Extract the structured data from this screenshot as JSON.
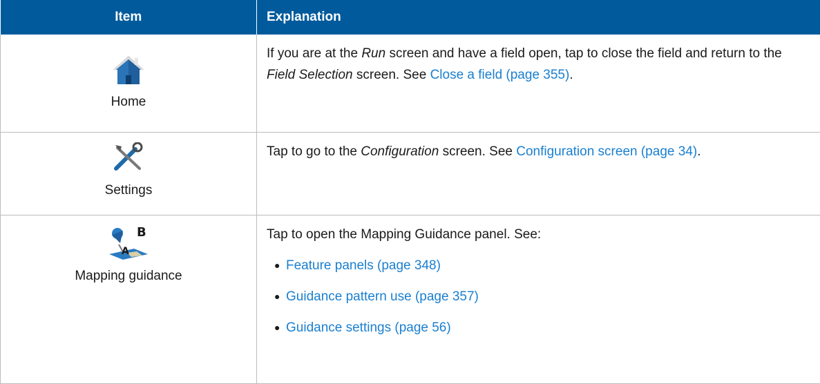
{
  "header": {
    "item": "Item",
    "explanation": "Explanation"
  },
  "rows": [
    {
      "icon": "home-icon",
      "label": "Home",
      "text": [
        "If you are at the ",
        "Run",
        " screen and have a field open, tap to close the field and return to the ",
        "Field Selection",
        " screen. See ",
        "Close a field (page 355)",
        "."
      ]
    },
    {
      "icon": "settings-icon",
      "label": "Settings",
      "text": [
        "Tap to go to the ",
        "Configuration",
        " screen. See ",
        "Configuration screen (page 34)",
        "."
      ]
    },
    {
      "icon": "mapping-guidance-icon",
      "label": "Mapping guidance",
      "text": [
        "Tap to open the Mapping Guidance panel. See:"
      ],
      "links": [
        "Feature panels (page 348)",
        "Guidance pattern use (page 357)",
        "Guidance settings (page 56)"
      ]
    }
  ],
  "colors": {
    "header_bg": "#005a9c",
    "link": "#1a7fcf",
    "border": "#bcbcbc"
  }
}
